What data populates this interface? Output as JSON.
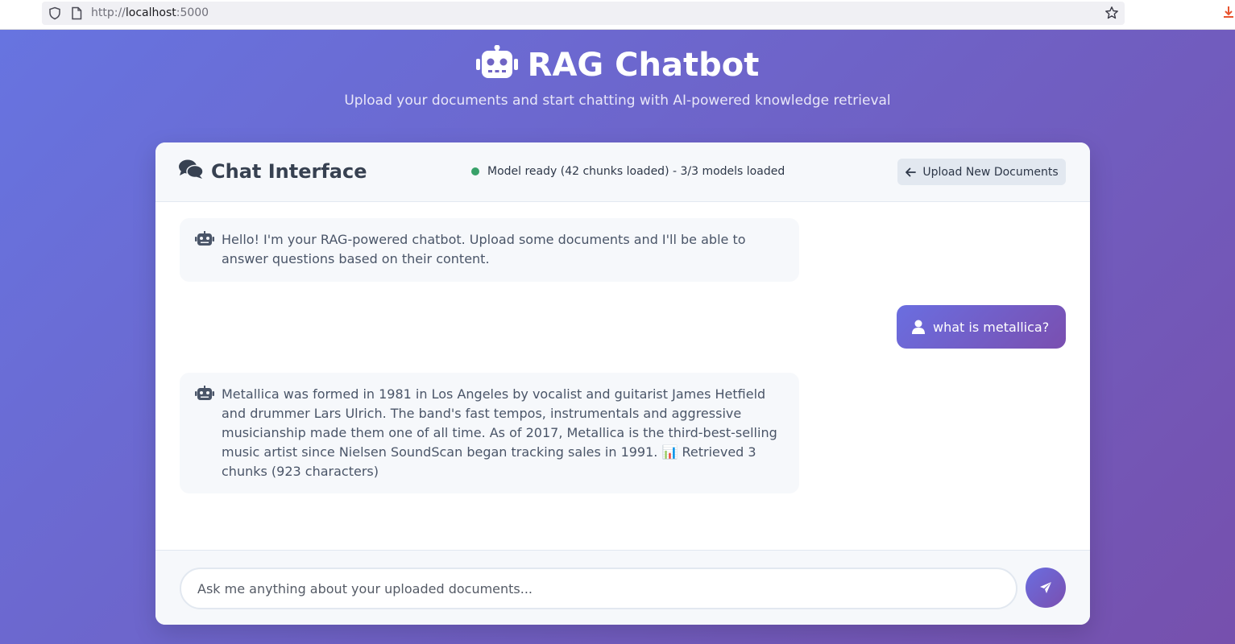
{
  "browser": {
    "url_scheme": "http://",
    "url_host": "localhost",
    "url_port": ":5000"
  },
  "header": {
    "title": "RAG Chatbot",
    "subtitle": "Upload your documents and start chatting with AI-powered knowledge retrieval"
  },
  "chat": {
    "title": "Chat Interface",
    "status_text": "Model ready (42 chunks loaded) - 3/3 models loaded",
    "status_color": "#38a169",
    "upload_button_label": "Upload New Documents",
    "messages": [
      {
        "role": "bot",
        "text": "Hello! I'm your RAG-powered chatbot. Upload some documents and I'll be able to answer questions based on their content."
      },
      {
        "role": "user",
        "text": "what is metallica?"
      },
      {
        "role": "bot",
        "text": "Metallica was formed in 1981 in Los Angeles by vocalist and guitarist James Hetfield and drummer Lars Ulrich. The band's fast tempos, instrumentals and aggressive musicianship made them one of all time. As of 2017, Metallica is the third-best-selling music artist since Nielsen SoundScan began tracking sales in 1991. 📊 Retrieved 3 chunks (923 characters)"
      }
    ],
    "input_placeholder": "Ask me anything about your uploaded documents...",
    "input_value": ""
  },
  "colors": {
    "gradient_start": "#6774e0",
    "gradient_end": "#7650ad",
    "accent": "#6a6ee0"
  },
  "icons": [
    "shield-icon",
    "page-icon",
    "bookmark-star-icon",
    "download-icon",
    "robot-icon",
    "comments-icon",
    "arrow-left-icon",
    "user-icon",
    "send-icon"
  ]
}
